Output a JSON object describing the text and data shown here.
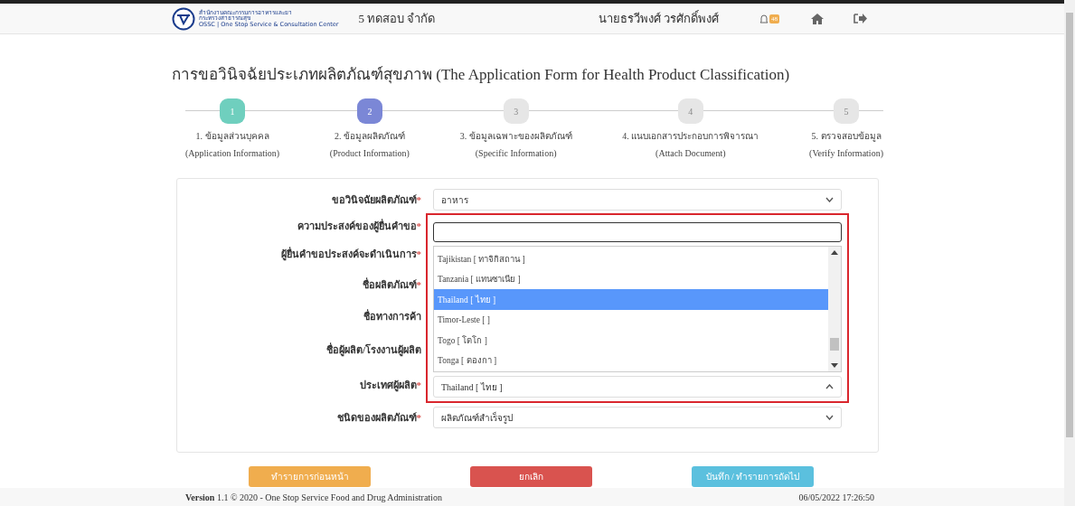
{
  "header": {
    "logo_lines": [
      "สำนักงานคณะกรรมการอาหารและยา",
      "กระทรวงสาธารณสุข",
      "OSSC | One Stop Service & Consultation Center"
    ],
    "company": "5 ทดสอบ จำกัด",
    "user": "นายธรวีพงศ์ วรศักดิ์พงศ์",
    "notification_count": "48"
  },
  "title": "การขอวินิจฉัยประเภทผลิตภัณฑ์สุขภาพ (The Application Form for Health Product Classification)",
  "steps": [
    {
      "number": "1",
      "label": "1. ข้อมูลส่วนบุคคล",
      "sublabel": "(Application Information)",
      "completed": true,
      "selected": false
    },
    {
      "number": "2",
      "label": "2. ข้อมูลผลิตภัณฑ์",
      "sublabel": "(Product Information)",
      "completed": false,
      "selected": true
    },
    {
      "number": "3",
      "label": "3. ข้อมูลเฉพาะของผลิตภัณฑ์",
      "sublabel": "(Specific Information)",
      "completed": false,
      "selected": false
    },
    {
      "number": "4",
      "label": "4. แนบเอกสารประกอบการพิจารณา",
      "sublabel": "(Attach Document)",
      "completed": false,
      "selected": false
    },
    {
      "number": "5",
      "label": "5. ตรวจสอบข้อมูล",
      "sublabel": "(Verify Information)",
      "completed": false,
      "selected": false
    }
  ],
  "fields": [
    {
      "label": "ขอวินิจฉัยผลิตภัณฑ์",
      "required_mark": "*",
      "value": "อาหาร"
    },
    {
      "label": "ความประสงค์ของผู้ยื่นคำขอ",
      "required_mark": "*"
    },
    {
      "label": "ผู้ยื่นคำขอประสงค์จะดำเนินการ",
      "required_mark": "*"
    },
    {
      "label": "ชื่อผลิตภัณฑ์",
      "required_mark": "*"
    },
    {
      "label": "ชื่อทางการค้า"
    },
    {
      "label": "ชื่อผู้ผลิต/โรงงานผู้ผลิต"
    },
    {
      "label": "ประเทศผู้ผลิต",
      "required_mark": "*",
      "value": "Thailand [ ไทย ]"
    },
    {
      "label": "ชนิดของผลิตภัณฑ์",
      "required_mark": "*",
      "value": "ผลิตภัณฑ์สำเร็จรูป"
    }
  ],
  "dropdown": {
    "options": [
      {
        "label": "Tajikistan [ ทาจิกิสถาน ]",
        "selected": false
      },
      {
        "label": "Tanzania [ แทนซาเนีย ]",
        "selected": false
      },
      {
        "label": "Thailand [ ไทย ]",
        "selected": true
      },
      {
        "label": "Timor-Leste [ ]",
        "selected": false
      },
      {
        "label": "Togo [ โตโก ]",
        "selected": false
      },
      {
        "label": "Tonga [ ตองกา ]",
        "selected": false
      }
    ]
  },
  "buttons": [
    {
      "label": "ทำรายการก่อนหน้า",
      "kind": "back"
    },
    {
      "label": "ยกเลิก",
      "kind": "cancel"
    },
    {
      "label": "บันทึก / ทำรายการถัดไป",
      "kind": "next"
    }
  ],
  "footer": {
    "version_label": "Version",
    "version_text": "1.1 © 2020 - One Stop Service Food and Drug Administration",
    "datetime": "06/05/2022 17:26:50"
  }
}
